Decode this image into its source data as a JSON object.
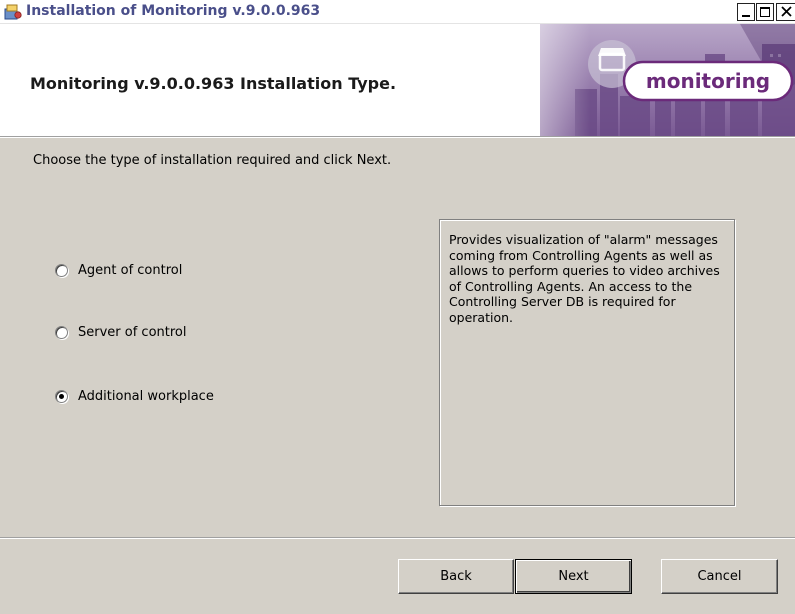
{
  "window": {
    "title": "Installation of Monitoring v.9.0.0.963",
    "controls": {
      "minimize": "minimize-icon",
      "maximize": "maximize-icon",
      "close": "close-icon"
    }
  },
  "banner": {
    "title": "Monitoring v.9.0.0.963 Installation Type.",
    "logo_text": "monitoring"
  },
  "instruction": "Choose the type of installation required and click Next.",
  "options": [
    {
      "label": "Agent of control",
      "selected": false
    },
    {
      "label": "Server of control",
      "selected": false
    },
    {
      "label": "Additional workplace",
      "selected": true
    }
  ],
  "description": "Provides visualization of \"alarm\" messages coming from Controlling Agents as well as allows to perform queries to video archives of Controlling Agents. An access to the Controlling Server DB is required for operation.",
  "buttons": {
    "back": "Back",
    "next": "Next",
    "cancel": "Cancel"
  },
  "colors": {
    "dialog_bg": "#d4d0c8",
    "title_text": "#4a4f8a",
    "logo_purple": "#6b2a7a"
  }
}
